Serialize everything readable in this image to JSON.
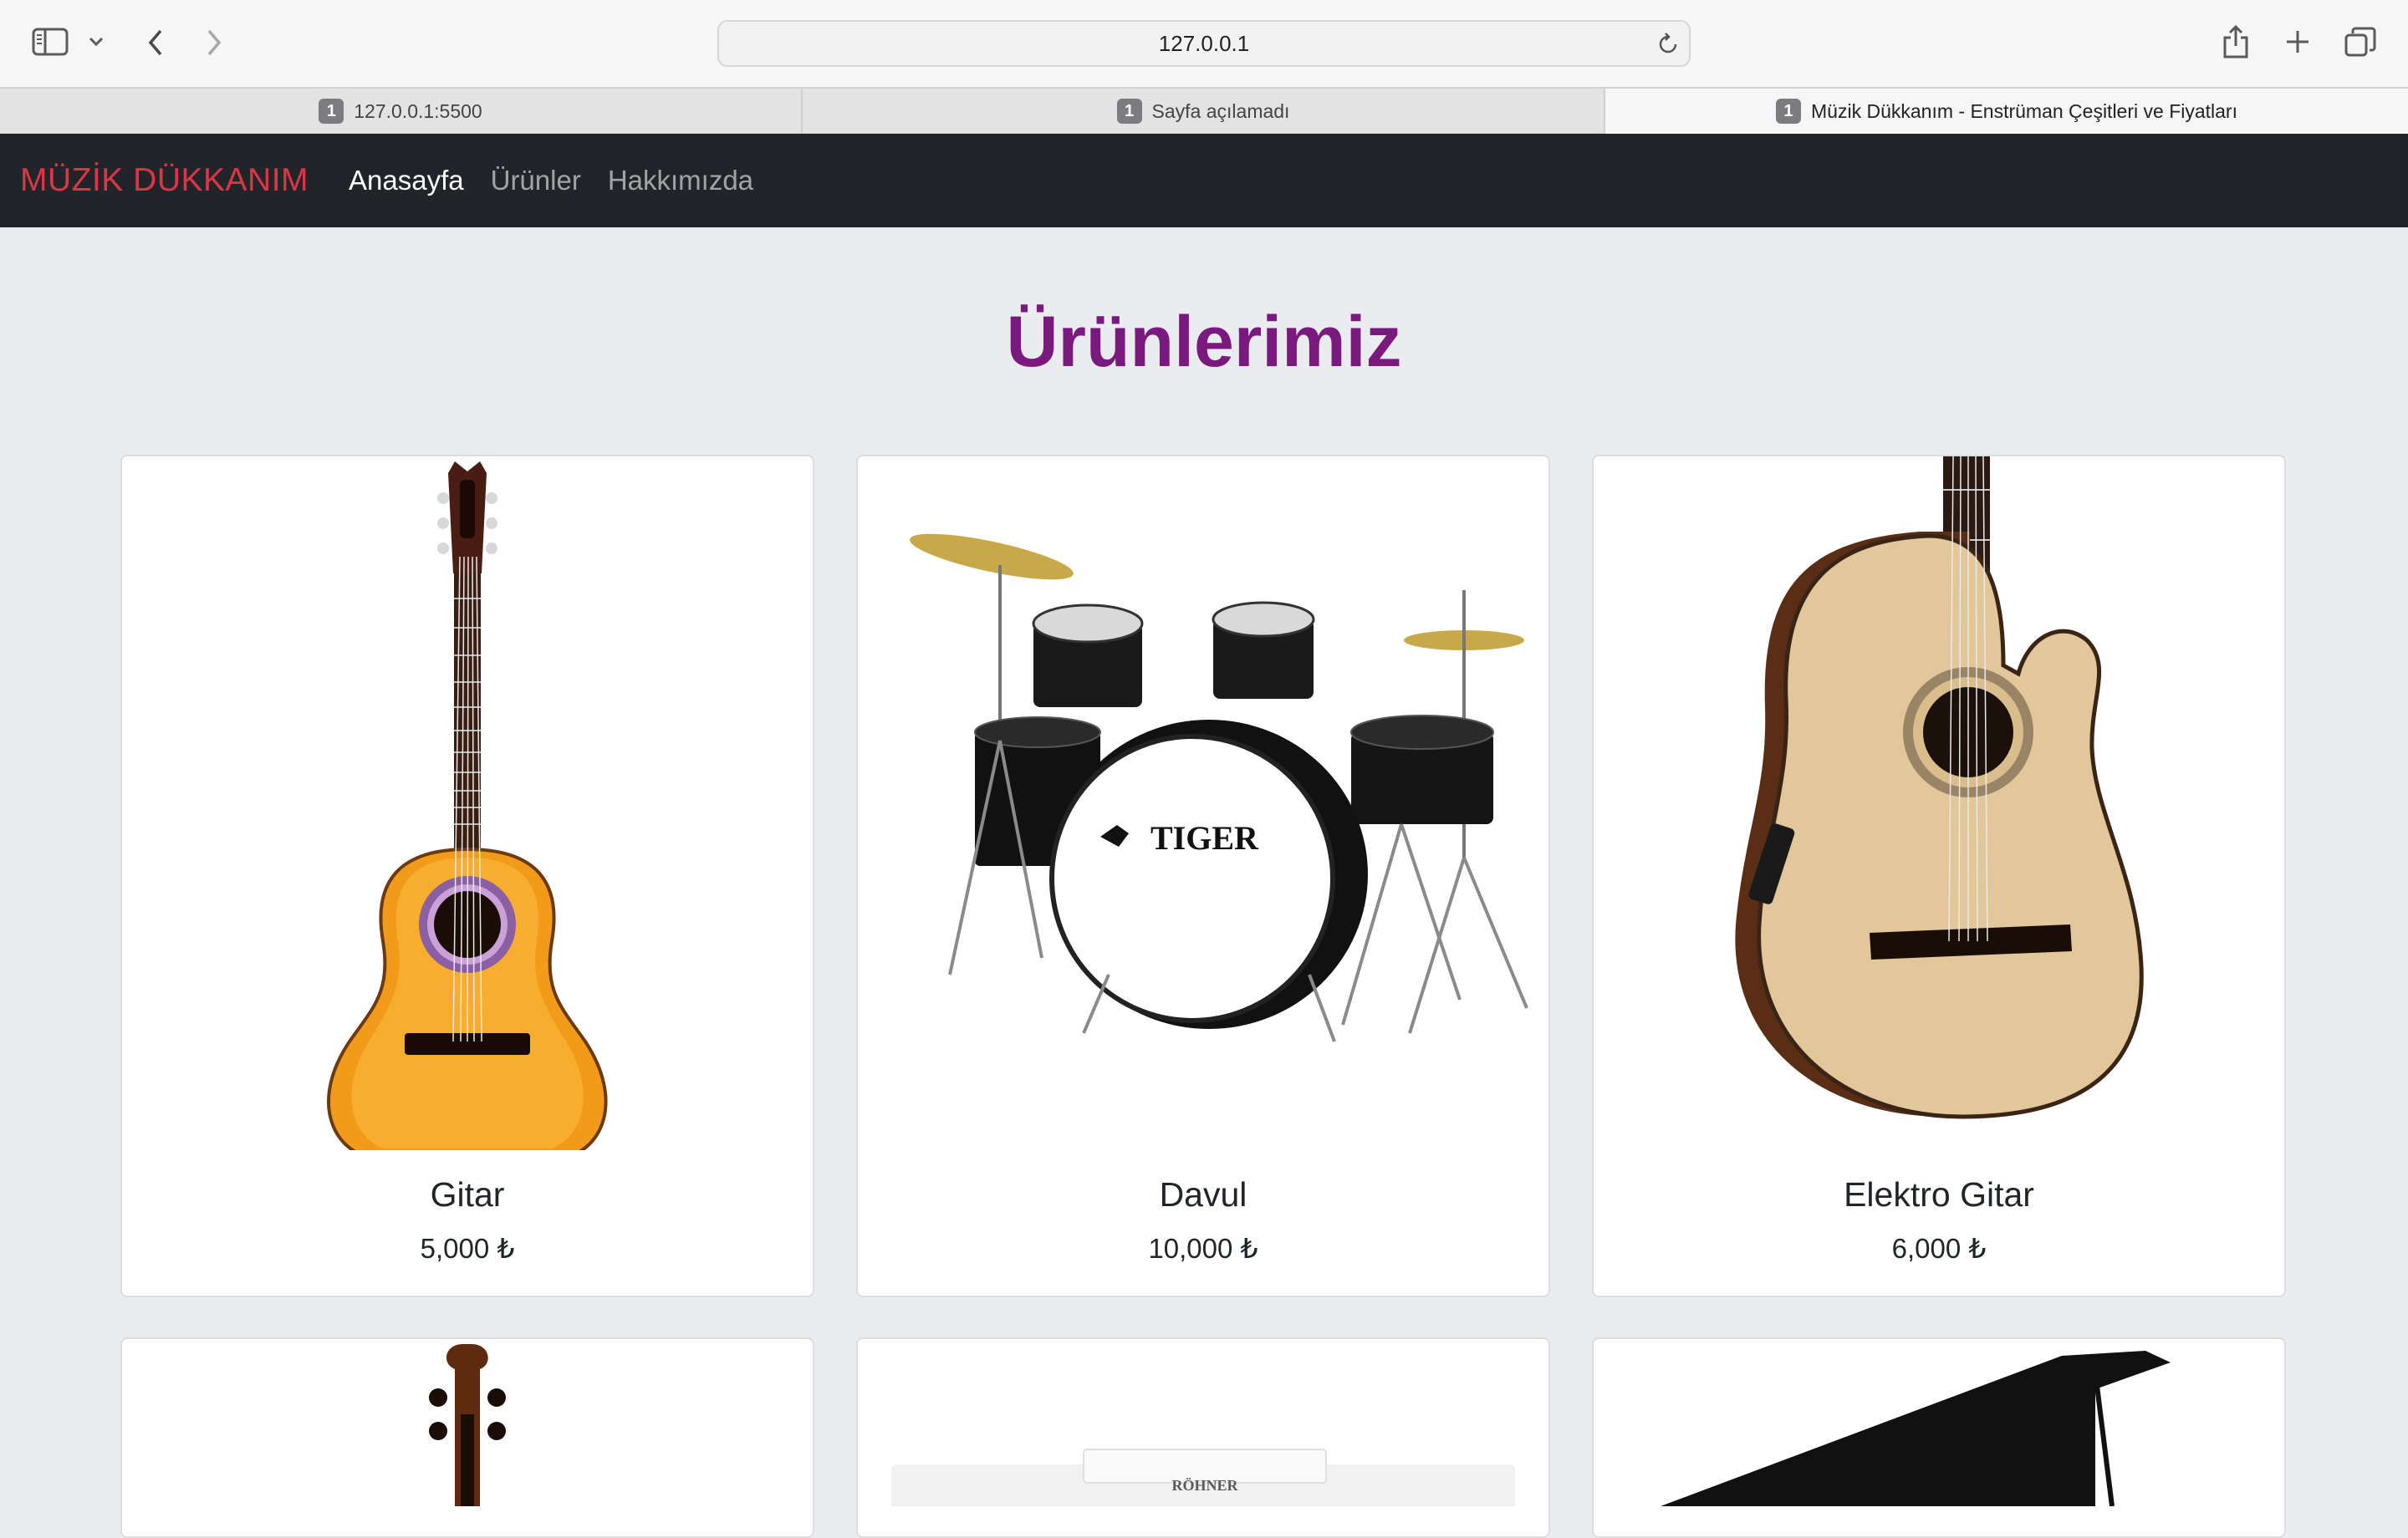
{
  "browser": {
    "url": "127.0.0.1",
    "tabs": [
      {
        "badge": "1",
        "label": "127.0.0.1:5500"
      },
      {
        "badge": "1",
        "label": "Sayfa açılamadı"
      },
      {
        "badge": "1",
        "label": "Müzik Dükkanım - Enstrüman Çeşitleri ve Fiyatları"
      }
    ]
  },
  "nav": {
    "brand": "MÜZİK DÜKKANIM",
    "links": [
      "Anasayfa",
      "Ürünler",
      "Hakkımızda"
    ]
  },
  "main": {
    "title": "Ürünlerimiz",
    "products": [
      {
        "name": "Gitar",
        "price": "5,000 ₺"
      },
      {
        "name": "Davul",
        "price": "10,000 ₺"
      },
      {
        "name": "Elektro Gitar",
        "price": "6,000 ₺"
      }
    ],
    "partial_row_brand_text": "RÖHNER"
  }
}
